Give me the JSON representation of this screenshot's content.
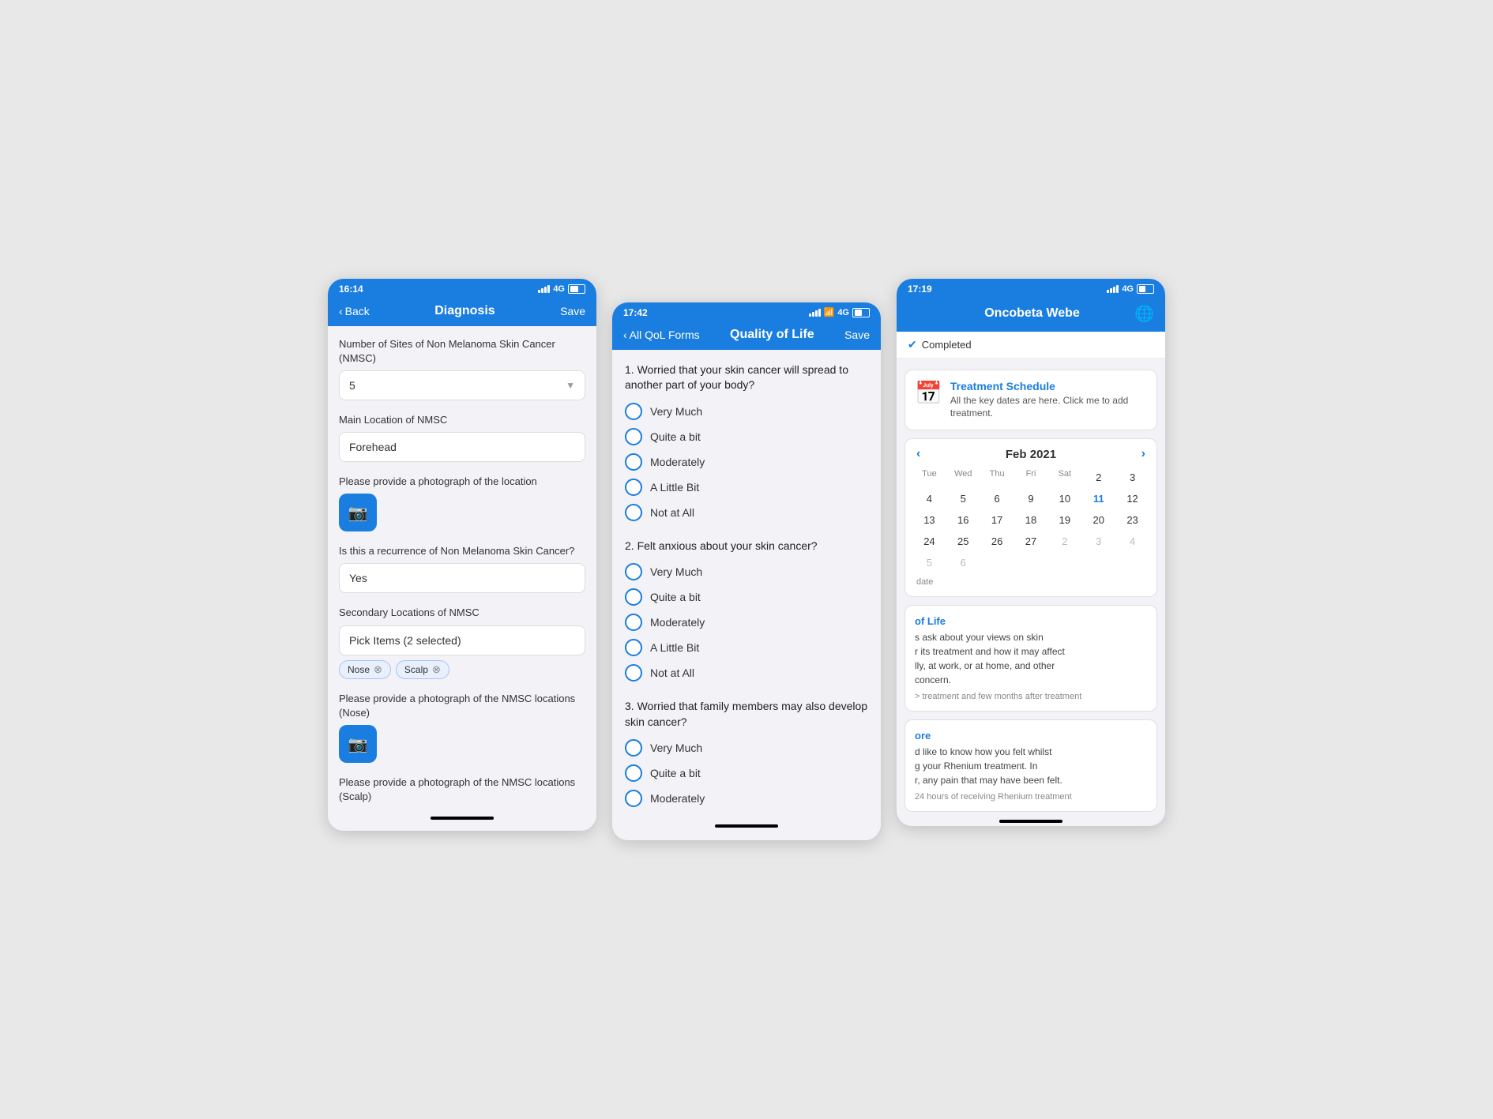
{
  "screen1": {
    "time": "16:14",
    "signal": "4G",
    "nav": {
      "back": "Back",
      "title": "Diagnosis",
      "save": "Save"
    },
    "fields": [
      {
        "label": "Number of Sites of Non Melanoma Skin Cancer (NMSC)",
        "value": "5",
        "type": "dropdown"
      },
      {
        "label": "Main Location of NMSC",
        "value": "Forehead",
        "type": "text"
      },
      {
        "label": "Please provide a photograph of the location",
        "type": "photo"
      },
      {
        "label": "Is this a recurrence of Non Melanoma Skin Cancer?",
        "value": "Yes",
        "type": "text"
      },
      {
        "label": "Secondary Locations of NMSC",
        "placeholder": "Pick Items (2 selected)",
        "type": "multiselect",
        "tags": [
          "Nose",
          "Scalp"
        ]
      },
      {
        "label": "Please provide a photograph of the NMSC locations (Nose)",
        "type": "photo"
      },
      {
        "label": "Please provide a photograph of the NMSC locations (Scalp)",
        "type": "photo_partial"
      }
    ]
  },
  "screen2": {
    "time": "17:42",
    "signal": "4G",
    "nav": {
      "back": "All QoL Forms",
      "title": "Quality of Life",
      "save": "Save"
    },
    "questions": [
      {
        "number": "1.",
        "text": "Worried that your skin cancer will spread to another part of your body?",
        "options": [
          "Very Much",
          "Quite a bit",
          "Moderately",
          "A Little Bit",
          "Not at All"
        ]
      },
      {
        "number": "2.",
        "text": "Felt anxious about your skin cancer?",
        "options": [
          "Very Much",
          "Quite a bit",
          "Moderately",
          "A Little Bit",
          "Not at All"
        ]
      },
      {
        "number": "3.",
        "text": "Worried that family members may also develop skin cancer?",
        "options": [
          "Very Much",
          "Quite a bit",
          "Moderately"
        ]
      }
    ]
  },
  "screen3": {
    "time": "17:19",
    "signal": "4G",
    "nav": {
      "title": "Oncobeta Webe"
    },
    "completed_label": "Completed",
    "treatment": {
      "title": "Treatment Schedule",
      "text": "All the key dates are here. Click me to add treatment."
    },
    "calendar": {
      "month": "Feb 2021",
      "days_of_week": [
        "Tue",
        "Wed",
        "Thu",
        "Fri",
        "Sat"
      ],
      "weeks": [
        [
          "2",
          "3",
          "4",
          "5",
          "6"
        ],
        [
          "9",
          "10",
          "11",
          "12",
          "13"
        ],
        [
          "16",
          "17",
          "18",
          "19",
          "20"
        ],
        [
          "23",
          "24",
          "25",
          "26",
          "27"
        ],
        [
          "2",
          "3",
          "4",
          "5",
          "6"
        ]
      ],
      "today": "11"
    },
    "sections": [
      {
        "title": "of Life",
        "text": "s ask about your views on skin\nr its treatment and how it may affect\nlly, at work, or at home, and other\nconcern.",
        "note": "> treatment and few months after treatment"
      },
      {
        "title": "ore",
        "text": "d like to know how you felt whilst\ng your Rhenium treatment. In\nr, any pain that may have been felt.",
        "note": "24 hours of receiving Rhenium treatment"
      }
    ]
  }
}
